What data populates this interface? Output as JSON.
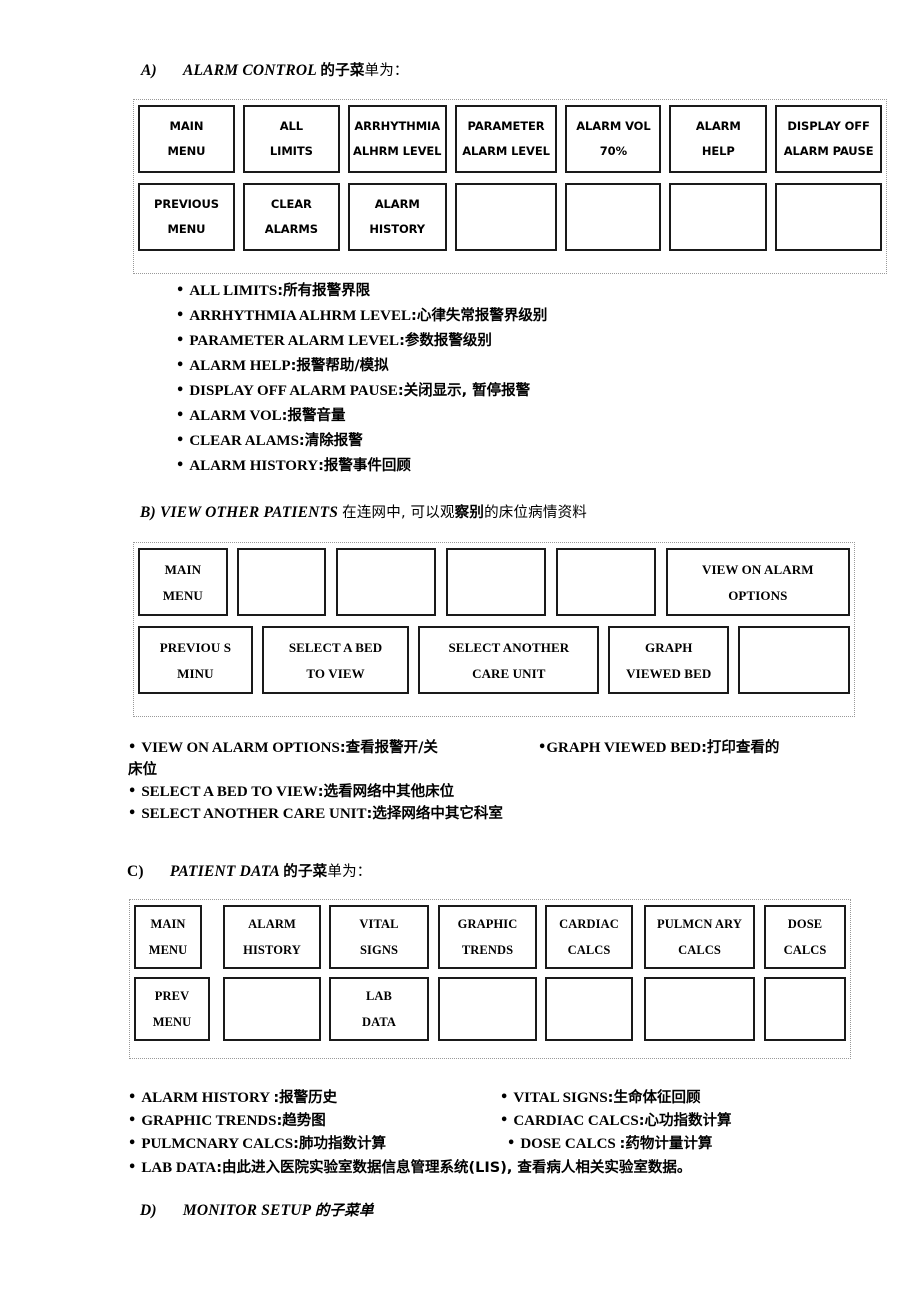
{
  "document": {
    "sections": [
      {
        "id": "alarm-control",
        "heading": {
          "marker": "A)",
          "title": "ALARM CONTROL",
          "suffix_cn": "的子菜",
          "suffix_cn2": "单为：",
          "full": "A)    ALARM CONTROL 的子菜单为："
        },
        "table": {
          "rows": [
            [
              {
                "lines": [
                  "MAIN",
                  "MENU"
                ]
              },
              {
                "lines": [
                  "ALL",
                  "LIMITS"
                ]
              },
              {
                "lines": [
                  "ARRHYTHMIA",
                  "ALHRM LEVEL"
                ]
              },
              {
                "lines": [
                  "PARAMETER",
                  "ALARM LEVEL"
                ]
              },
              {
                "lines": [
                  "ALARM VOL",
                  "70%"
                ]
              },
              {
                "lines": [
                  "ALARM",
                  "HELP"
                ]
              },
              {
                "lines": [
                  "DISPLAY OFF",
                  "ALARM PAUSE"
                ]
              }
            ],
            [
              {
                "lines": [
                  "PREVIOUS",
                  "MENU"
                ]
              },
              {
                "lines": [
                  "CLEAR",
                  "ALARMS"
                ]
              },
              {
                "lines": [
                  "ALARM",
                  "HISTORY"
                ]
              },
              {
                "lines": []
              },
              {
                "lines": []
              },
              {
                "lines": []
              },
              {
                "lines": []
              }
            ]
          ]
        },
        "bullets": [
          {
            "en": "ALL LIMITS",
            "cn": ":所有报警界限"
          },
          {
            "en": "ARRHYTHMIA ALHRM LEVEL",
            "cn": ":心律失常报警界级别"
          },
          {
            "en": "PARAMETER ALARM LEVEL",
            "cn": ":参数报警级别"
          },
          {
            "en": "ALARM HELP",
            "cn": ":报警帮助/模拟"
          },
          {
            "en": "DISPLAY OFF ALARM PAUSE",
            "cn": ":关闭显示, 暂停报警"
          },
          {
            "en": "ALARM VOL",
            "cn": ":报警音量"
          },
          {
            "en": "CLEAR ALAMS",
            "cn": ":清除报警"
          },
          {
            "en": "ALARM HISTORY",
            "cn": ":报警事件回顾"
          }
        ]
      },
      {
        "id": "view-other-patients",
        "heading": {
          "marker": "B)",
          "title": "VIEW OTHER PATIENTS",
          "suffix_cn": "在连网中, 可以观",
          "suffix_cn2": "察别",
          "suffix_cn3": "的床位病情资料",
          "full": "B) VIEW OTHER PATIENTS 在连网中, 可以观察别的床位病情资料"
        },
        "table": {
          "rows": [
            [
              {
                "lines": [
                  "MAIN",
                  "MENU"
                ]
              },
              {
                "lines": []
              },
              {
                "lines": []
              },
              {
                "lines": []
              },
              {
                "lines": []
              },
              {
                "lines": [
                  "VIEW ON ALARM",
                  "OPTIONS"
                ]
              }
            ],
            [
              {
                "lines": [
                  "PREVIOU S",
                  "MINU"
                ]
              },
              {
                "lines": [
                  "SELECT A BED",
                  "TO VIEW"
                ]
              },
              {
                "lines": [
                  "SELECT ANOTHER",
                  "CARE UNIT"
                ]
              },
              {
                "lines": [
                  "GRAPH",
                  "VIEWED BED"
                ]
              },
              {
                "lines": []
              }
            ]
          ]
        },
        "bullets_left": [
          {
            "en": "VIEW ON ALARM OPTIONS",
            "cn": ":查看报警开/关"
          },
          {
            "cont": "床位"
          },
          {
            "en": "SELECT A BED TO VIEW",
            "cn": ":选看网络中其他床位"
          },
          {
            "en": "SELECT ANOTHER CARE UNIT",
            "cn": ":选择网络中其它科室"
          }
        ],
        "bullets_right": [
          {
            "en": "GRAPH VIEWED BED",
            "cn": ":打印查看的"
          }
        ]
      },
      {
        "id": "patient-data",
        "heading": {
          "marker": "C)",
          "title": "PATIENT DATA",
          "suffix_cn": "的子菜",
          "suffix_cn2": "单为：",
          "full": "C)    PATIENT DATA 的子菜单为："
        },
        "table": {
          "rows": [
            [
              {
                "lines": [
                  "MAIN",
                  "MENU"
                ]
              },
              {
                "lines": [
                  "ALARM",
                  "HISTORY"
                ]
              },
              {
                "lines": [
                  "VITAL",
                  "SIGNS"
                ]
              },
              {
                "lines": [
                  "GRAPHIC",
                  "TRENDS"
                ]
              },
              {
                "lines": [
                  "CARDIAC",
                  "CALCS"
                ]
              },
              {
                "lines": [
                  "PULMCN ARY",
                  "CALCS"
                ]
              },
              {
                "lines": [
                  "DOSE",
                  "CALCS"
                ]
              }
            ],
            [
              {
                "lines": [
                  "PREV",
                  "MENU"
                ]
              },
              {
                "lines": []
              },
              {
                "lines": [
                  "LAB",
                  "DATA"
                ]
              },
              {
                "lines": []
              },
              {
                "lines": []
              },
              {
                "lines": []
              },
              {
                "lines": []
              }
            ]
          ]
        },
        "bullets_left": [
          {
            "en": "ALARM HISTORY ",
            "cn": ":报警历史"
          },
          {
            "en": "GRAPHIC TRENDS",
            "cn": ":趋势图"
          },
          {
            "en": "PULMCNARY CALCS",
            "cn": ":肺功指数计算"
          }
        ],
        "bullets_right": [
          {
            "en": "VITAL SIGNS",
            "cn": ":生命体征回顾"
          },
          {
            "en": "CARDIAC CALCS",
            "cn": ":心功指数计算"
          },
          {
            "en": "DOSE CALCS ",
            "cn": ":药物计量计算"
          }
        ],
        "bullets_full": [
          {
            "en": "LAB DATA",
            "cn": ":由此进入医院实验室数据信息管理系统(LIS), 查看病人相关实验室数据。"
          }
        ]
      },
      {
        "id": "monitor-setup",
        "heading": {
          "marker": "D)",
          "title": "MONITOR SETUP",
          "suffix_cn": "的子菜单",
          "full": "D)    MONITOR SETUP 的子菜单"
        }
      }
    ]
  }
}
